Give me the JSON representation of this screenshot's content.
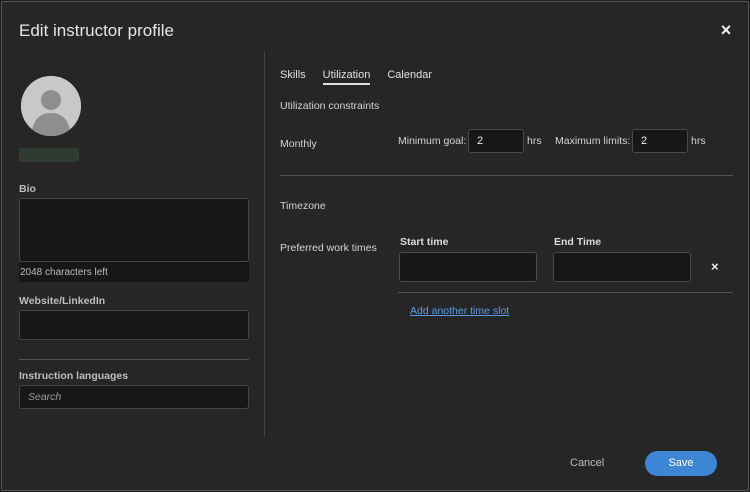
{
  "dialog": {
    "title": "Edit instructor profile",
    "close_glyph": "×"
  },
  "profile": {
    "bio_label": "Bio",
    "bio_chars_left": "2048 characters left",
    "website_label": "Website/LinkedIn",
    "languages_label": "Instruction languages",
    "search_placeholder": "Search"
  },
  "tabs": [
    {
      "label": "Skills",
      "active": false
    },
    {
      "label": "Utilization",
      "active": true
    },
    {
      "label": "Calendar",
      "active": false
    }
  ],
  "utilization": {
    "section_title": "Utilization constraints",
    "period_label": "Monthly",
    "min_goal_label": "Minimum goal:",
    "min_goal_value": "2",
    "max_limit_label": "Maximum limits:",
    "max_limit_value": "2",
    "unit": "hrs"
  },
  "schedule": {
    "timezone_label": "Timezone",
    "work_times_label": "Preferred work times",
    "start_label": "Start time",
    "end_label": "End Time",
    "remove_glyph": "×",
    "add_slot_link": "Add another time slot"
  },
  "footer": {
    "cancel_label": "Cancel",
    "save_label": "Save"
  },
  "colors": {
    "accent": "#3d86d6",
    "link": "#5a9be8",
    "background": "#262626"
  },
  "icons": {
    "close": "close-icon",
    "avatar": "user-silhouette-icon",
    "remove": "remove-slot-icon"
  }
}
